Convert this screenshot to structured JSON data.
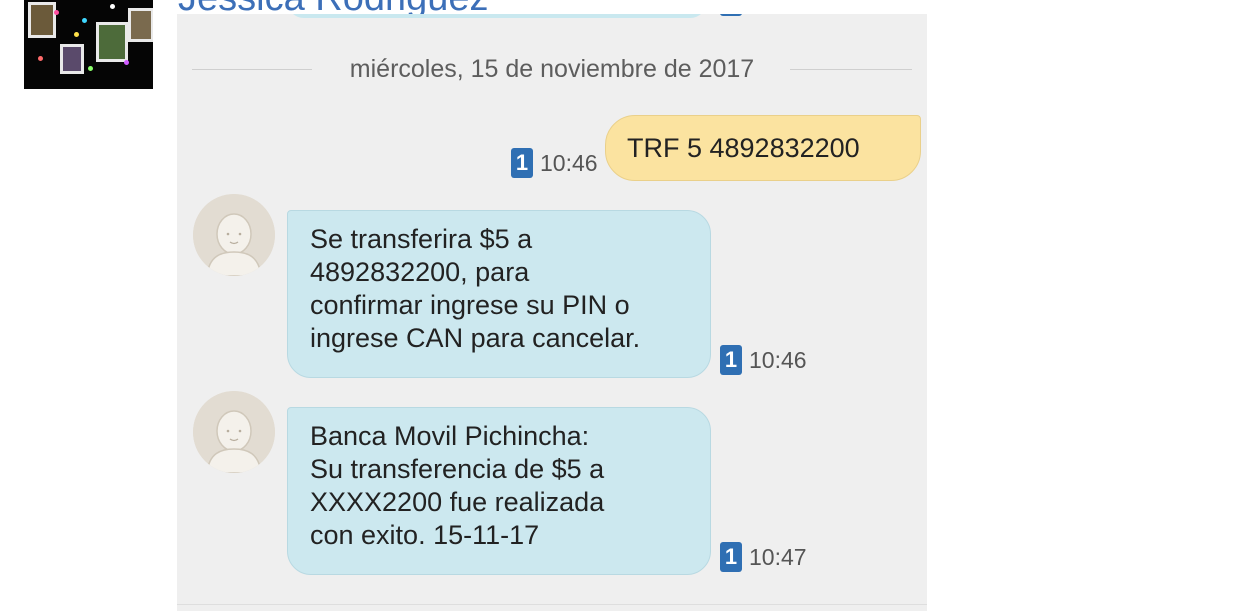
{
  "header": {
    "contact_name": "Jessica Rodriguez"
  },
  "conversation": {
    "date_separator": "miércoles, 15 de noviembre de 2017",
    "messages": [
      {
        "direction": "outgoing",
        "text": "TRF 5 4892832200",
        "sim": "1",
        "time": "10:46"
      },
      {
        "direction": "incoming",
        "lines": [
          "Se transferira $5 a",
          "4892832200, para",
          "confirmar ingrese su PIN o",
          "ingrese CAN para cancelar."
        ],
        "sim": "1",
        "time": "10:46"
      },
      {
        "direction": "incoming",
        "lines": [
          "Banca Movil Pichincha:",
          "Su transferencia de $5 a",
          "XXXX2200 fue realizada",
          "con exito. 15-11-17"
        ],
        "sim": "1",
        "time": "10:47"
      }
    ]
  },
  "colors": {
    "outgoing_bubble": "#fbe3a0",
    "incoming_bubble": "#cce8ef",
    "sim_badge": "#2f6fb3",
    "contact_name": "#3c6fb8"
  },
  "icons": {
    "sim_badge": "sim-1-icon",
    "avatar": "default-contact-avatar-icon"
  }
}
